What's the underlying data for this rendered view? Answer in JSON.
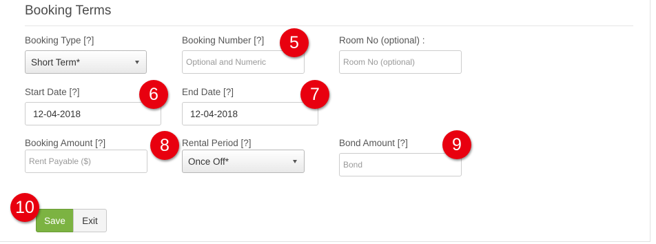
{
  "section": {
    "title": "Booking Terms"
  },
  "fields": {
    "booking_type": {
      "label": "Booking Type [?]",
      "value": "Short Term*"
    },
    "booking_number": {
      "label": "Booking Number [?]",
      "placeholder": "Optional and Numeric"
    },
    "room_no": {
      "label": "Room No (optional) :",
      "placeholder": "Room No (optional)"
    },
    "start_date": {
      "label": "Start Date [?]",
      "value": "12-04-2018"
    },
    "end_date": {
      "label": "End Date [?]",
      "value": "12-04-2018"
    },
    "booking_amount": {
      "label": "Booking Amount [?]",
      "placeholder": "Rent Payable ($)"
    },
    "rental_period": {
      "label": "Rental Period [?]",
      "value": "Once Off*"
    },
    "bond_amount": {
      "label": "Bond Amount [?]",
      "placeholder": "Bond"
    }
  },
  "buttons": {
    "save": "Save",
    "exit": "Exit"
  },
  "annotations": {
    "n5": "5",
    "n6": "6",
    "n7": "7",
    "n8": "8",
    "n9": "9",
    "n10": "10"
  },
  "colors": {
    "badge": "#e8000f",
    "save_button": "#7cb342"
  }
}
